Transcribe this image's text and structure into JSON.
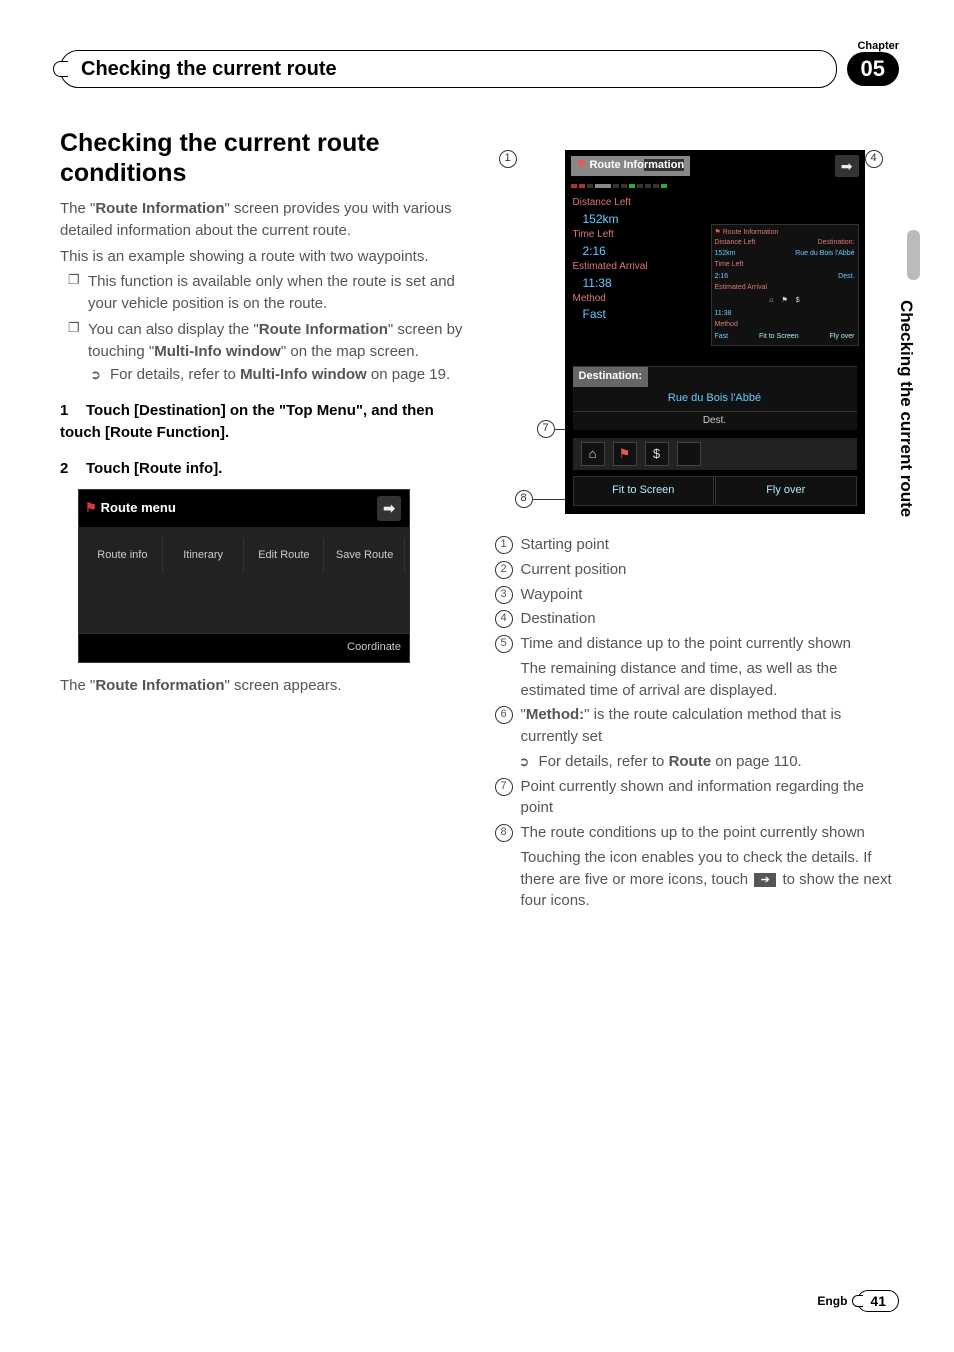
{
  "chapter_label": "Chapter",
  "chapter_num": "05",
  "header_title": "Checking the current route",
  "side_tab": "Checking the current route",
  "h1": "Checking the current route conditions",
  "intro_p1_a": "The \"",
  "intro_p1_bold": "Route Information",
  "intro_p1_b": "\" screen provides you with various detailed information about the current route.",
  "intro_p2": "This is an example showing a route with two waypoints.",
  "note1": "This function is available only when the route is set and your vehicle position is on the route.",
  "note2_a": "You can also display the \"",
  "note2_bold1": "Route Information",
  "note2_b": "\" screen by touching \"",
  "note2_bold2": "Multi-Info window",
  "note2_c": "\" on the map screen.",
  "note2_sub_a": "For details, refer to ",
  "note2_sub_bold": "Multi-Info window",
  "note2_sub_b": " on page 19.",
  "step1": "Touch [Destination] on the \"Top Menu\", and then touch [Route Function].",
  "step2": "Touch [Route info].",
  "route_menu": {
    "title": "Route menu",
    "buttons": [
      "Route info",
      "Itinerary",
      "Edit Route",
      "Save Route"
    ],
    "footer": "Coordinate"
  },
  "after_menu_a": "The \"",
  "after_menu_bold": "Route Information",
  "after_menu_b": "\" screen appears.",
  "diagram": {
    "title_a": "Route Info",
    "title_b": "rmation",
    "distance_label": "Distance Left",
    "distance_value": "152km",
    "time_label": "Time Left",
    "time_value": "2:16",
    "eta_label": "Estimated Arrival",
    "eta_value": "11:38",
    "method_label": "Method",
    "method_value": "Fast",
    "mini": {
      "title": "Route Information",
      "dist_l": "Distance Left",
      "dist_v": "152km",
      "dest_l": "Destination:",
      "dest_v": "Rue du Bois l'Abbé",
      "time_l": "Time Left",
      "time_v": "2:16",
      "dest_btn": "Dest.",
      "eta_l": "Estimated Arrival",
      "eta_v": "11:38",
      "method_l": "Method",
      "method_v": "Fast",
      "b1": "Fit to Screen",
      "b2": "Fly over"
    },
    "dest_label": "Destination:",
    "dest_value": "Rue du Bois l'Abbé",
    "dest_btn": "Dest.",
    "bottom_b1": "Fit to Screen",
    "bottom_b2": "Fly over"
  },
  "legend": {
    "i1": "Starting point",
    "i2": "Current position",
    "i3": "Waypoint",
    "i4": "Destination",
    "i5": "Time and distance up to the point currently shown",
    "i5_sub": "The remaining distance and time, as well as the estimated time of arrival are displayed.",
    "i6_a": "\"",
    "i6_bold": "Method:",
    "i6_b": "\" is the route calculation method that is currently set",
    "i6_sub_a": "For details, refer to ",
    "i6_sub_bold": "Route",
    "i6_sub_b": " on page 110.",
    "i7": "Point currently shown and information regarding the point",
    "i8": "The route conditions up to the point currently shown",
    "i8_sub_a": "Touching the icon enables you to check the details. If there are five or more icons, touch ",
    "i8_sub_b": " to show the next four icons."
  },
  "footer_lang": "Engb",
  "footer_page": "41"
}
